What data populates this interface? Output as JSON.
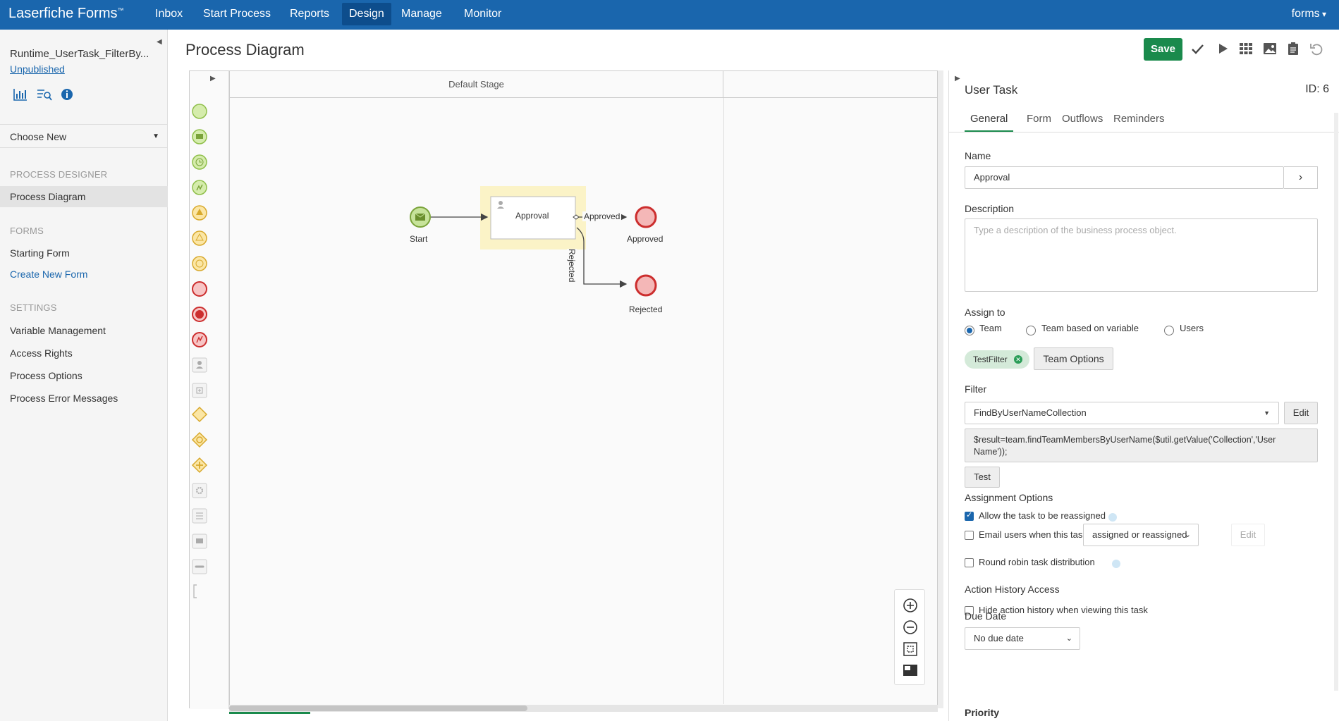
{
  "app": {
    "brand": "Laserfiche Forms",
    "trademark": "™"
  },
  "nav": {
    "items": [
      "Inbox",
      "Start Process",
      "Reports",
      "Design",
      "Manage",
      "Monitor"
    ],
    "active": "Design",
    "user": "forms"
  },
  "sidebar": {
    "process_name": "Runtime_UserTask_FilterBy...",
    "status": "Unpublished",
    "choose_new": "Choose New",
    "sections": {
      "designer": "PROCESS DESIGNER",
      "forms": "FORMS",
      "settings": "SETTINGS"
    },
    "designer_items": [
      "Process Diagram"
    ],
    "forms_items": [
      "Starting Form",
      "Create New Form"
    ],
    "settings_items": [
      "Variable Management",
      "Access Rights",
      "Process Options",
      "Process Error Messages"
    ]
  },
  "main": {
    "title": "Process Diagram",
    "save_label": "Save"
  },
  "diagram": {
    "stage": "Default Stage",
    "start_label": "Start",
    "task_label": "Approval",
    "flow_approved": "Approved",
    "flow_rejected": "Rejected",
    "end_approved": "Approved",
    "end_rejected": "Rejected"
  },
  "panel": {
    "title": "User Task",
    "id": "ID: 6",
    "tabs": [
      "General",
      "Form",
      "Outflows",
      "Reminders"
    ],
    "active_tab": "General",
    "name_label": "Name",
    "name_value": "Approval",
    "description_label": "Description",
    "description_placeholder": "Type a description of the business process object.",
    "assign_label": "Assign to",
    "assign_options": [
      "Team",
      "Team based on variable",
      "Users"
    ],
    "assign_selected": "Team",
    "team_chip": "TestFilter",
    "team_options": "Team Options",
    "filter_label": "Filter",
    "filter_value": "FindByUserNameCollection",
    "filter_edit": "Edit",
    "filter_expression": "$result=team.findTeamMembersByUserName($util.getValue('Collection','User Name'));",
    "test_label": "Test",
    "assignment_options_label": "Assignment Options",
    "opt_reassign": "Allow the task to be reassigned",
    "opt_email": "Email users when this task is",
    "email_select": "assigned or reassigned",
    "email_edit": "Edit",
    "opt_round_robin": "Round robin task distribution",
    "history_label": "Action History Access",
    "opt_hide_history": "Hide action history when viewing this task",
    "due_label": "Due Date",
    "due_select": "No due date",
    "priority_label": "Priority"
  },
  "colors": {
    "nav_bg": "#1a66ad",
    "save_green": "#1a8a4c",
    "start_event": "#c7e39a",
    "end_event": "#f4b7b7",
    "task_highlight": "#fbf3c7"
  }
}
